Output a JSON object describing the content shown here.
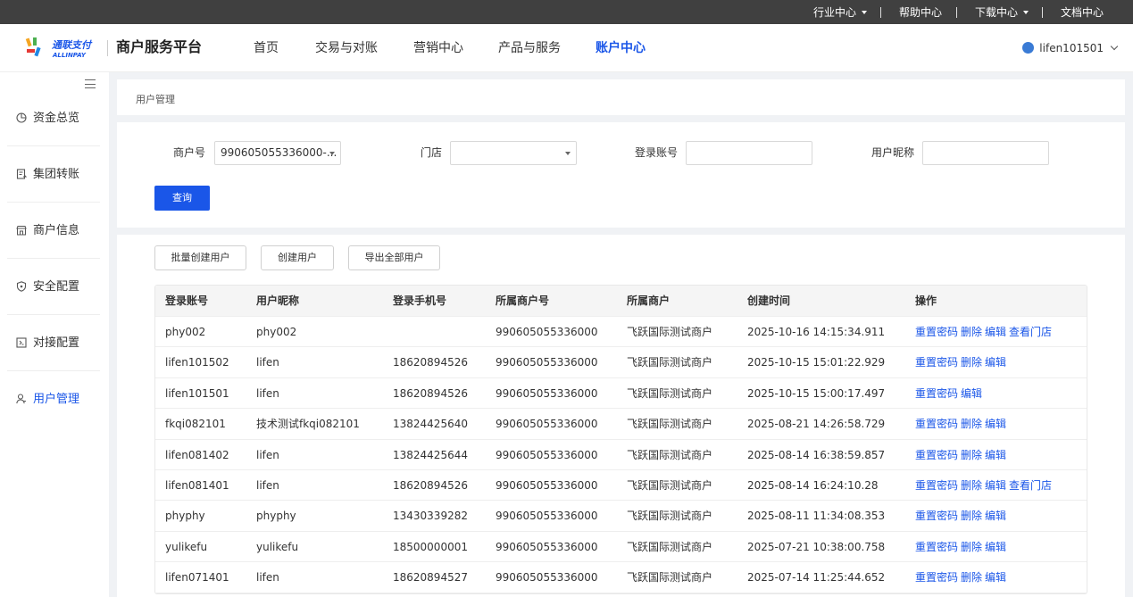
{
  "topbar": {
    "industry": "行业中心",
    "help": "帮助中心",
    "download": "下载中心",
    "docs": "文档中心"
  },
  "header": {
    "logo_cn": "通联支付",
    "logo_en": "ALLINPAY",
    "platform": "商户服务平台",
    "nav": [
      "首页",
      "交易与对账",
      "营销中心",
      "产品与服务",
      "账户中心"
    ],
    "active_nav": "账户中心",
    "username": "lifen101501"
  },
  "sidebar": {
    "items": [
      {
        "label": "资金总览",
        "icon": "pie-chart-icon"
      },
      {
        "label": "集团转账",
        "icon": "transfer-doc-icon"
      },
      {
        "label": "商户信息",
        "icon": "store-icon"
      },
      {
        "label": "安全配置",
        "icon": "shield-icon"
      },
      {
        "label": "对接配置",
        "icon": "connect-icon"
      },
      {
        "label": "用户管理",
        "icon": "user-icon"
      }
    ],
    "active": "用户管理"
  },
  "breadcrumb": "用户管理",
  "filters": {
    "merchant_label": "商户号",
    "merchant_value": "990605055336000-...",
    "store_label": "门店",
    "store_value": "",
    "login_label": "登录账号",
    "login_value": "",
    "nickname_label": "用户昵称",
    "nickname_value": "",
    "query_button": "查询"
  },
  "actions": {
    "batch_create": "批量创建用户",
    "create": "创建用户",
    "export_all": "导出全部用户"
  },
  "table": {
    "columns": [
      "登录账号",
      "用户昵称",
      "登录手机号",
      "所属商户号",
      "所属商户",
      "创建时间",
      "操作"
    ],
    "rows": [
      {
        "login": "phy002",
        "nickname": "phy002",
        "phone": "",
        "merchant_no": "990605055336000",
        "merchant": "飞跃国际测试商户",
        "created": "2025-10-16 14:15:34.911",
        "ops": [
          "重置密码",
          "删除",
          "编辑",
          "查看门店"
        ]
      },
      {
        "login": "lifen101502",
        "nickname": "lifen",
        "phone": "18620894526",
        "merchant_no": "990605055336000",
        "merchant": "飞跃国际测试商户",
        "created": "2025-10-15 15:01:22.929",
        "ops": [
          "重置密码",
          "删除",
          "编辑"
        ]
      },
      {
        "login": "lifen101501",
        "nickname": "lifen",
        "phone": "18620894526",
        "merchant_no": "990605055336000",
        "merchant": "飞跃国际测试商户",
        "created": "2025-10-15 15:00:17.497",
        "ops": [
          "重置密码",
          "编辑"
        ]
      },
      {
        "login": "fkqi082101",
        "nickname": "技术测试fkqi082101",
        "phone": "13824425640",
        "merchant_no": "990605055336000",
        "merchant": "飞跃国际测试商户",
        "created": "2025-08-21 14:26:58.729",
        "ops": [
          "重置密码",
          "删除",
          "编辑"
        ]
      },
      {
        "login": "lifen081402",
        "nickname": "lifen",
        "phone": "13824425644",
        "merchant_no": "990605055336000",
        "merchant": "飞跃国际测试商户",
        "created": "2025-08-14 16:38:59.857",
        "ops": [
          "重置密码",
          "删除",
          "编辑"
        ]
      },
      {
        "login": "lifen081401",
        "nickname": "lifen",
        "phone": "18620894526",
        "merchant_no": "990605055336000",
        "merchant": "飞跃国际测试商户",
        "created": "2025-08-14 16:24:10.28",
        "ops": [
          "重置密码",
          "删除",
          "编辑",
          "查看门店"
        ]
      },
      {
        "login": "phyphy",
        "nickname": "phyphy",
        "phone": "13430339282",
        "merchant_no": "990605055336000",
        "merchant": "飞跃国际测试商户",
        "created": "2025-08-11 11:34:08.353",
        "ops": [
          "重置密码",
          "删除",
          "编辑"
        ]
      },
      {
        "login": "yulikefu",
        "nickname": "yulikefu",
        "phone": "18500000001",
        "merchant_no": "990605055336000",
        "merchant": "飞跃国际测试商户",
        "created": "2025-07-21 10:38:00.758",
        "ops": [
          "重置密码",
          "删除",
          "编辑"
        ]
      },
      {
        "login": "lifen071401",
        "nickname": "lifen",
        "phone": "18620894527",
        "merchant_no": "990605055336000",
        "merchant": "飞跃国际测试商户",
        "created": "2025-07-14 11:25:44.652",
        "ops": [
          "重置密码",
          "删除",
          "编辑"
        ]
      }
    ]
  },
  "colors": {
    "accent": "#1a56e8",
    "topbar": "#404040"
  }
}
